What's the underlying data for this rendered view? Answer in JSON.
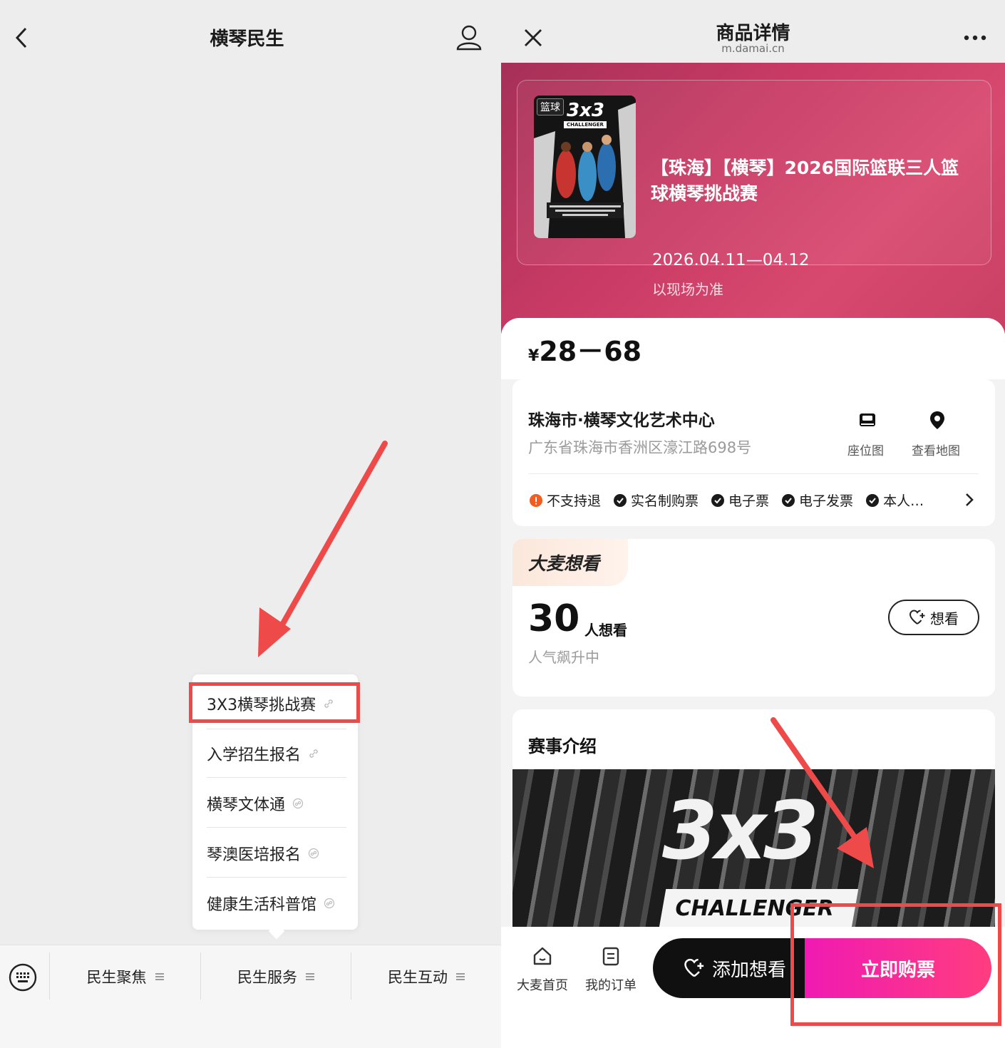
{
  "left_panel": {
    "title": "横琴民生",
    "popup_menu": {
      "items": [
        {
          "label": "3X3横琴挑战赛",
          "highlighted": true
        },
        {
          "label": "入学招生报名"
        },
        {
          "label": "横琴文体通"
        },
        {
          "label": "琴澳医培报名"
        },
        {
          "label": "健康生活科普馆"
        }
      ]
    },
    "bottom_menu": {
      "tabs": [
        {
          "label": "民生聚焦"
        },
        {
          "label": "民生服务"
        },
        {
          "label": "民生互动"
        }
      ]
    }
  },
  "right_panel": {
    "header": {
      "title": "商品详情",
      "url": "m.damai.cn"
    },
    "event": {
      "poster_tag": "篮球",
      "poster_logo": "3x3",
      "poster_sub": "CHALLENGER",
      "name": "【珠海】【横琴】2026国际篮联三人篮球横琴挑战赛",
      "date": "2026.04.11—04.12",
      "note": "以现场为准"
    },
    "price": {
      "currency": "¥",
      "range": "28－68"
    },
    "venue": {
      "name": "珠海市·横琴文化艺术中心",
      "address": "广东省珠海市香洲区濠江路698号",
      "seat_map_label": "座位图",
      "map_label": "查看地图",
      "tags": [
        {
          "label": "不支持退",
          "type": "warn"
        },
        {
          "label": "实名制购票",
          "type": "ok"
        },
        {
          "label": "电子票",
          "type": "ok"
        },
        {
          "label": "电子发票",
          "type": "ok"
        },
        {
          "label": "本人…",
          "type": "ok"
        }
      ]
    },
    "want": {
      "badge": "大麦想看",
      "count": "30",
      "count_unit": "人想看",
      "trend": "人气飙升中",
      "button": "想看"
    },
    "intro": {
      "title": "赛事介绍",
      "image_text": "3x3",
      "image_sub": "CHALLENGER"
    },
    "bottom_bar": {
      "home": "大麦首页",
      "orders": "我的订单",
      "add_want": "添加想看",
      "buy": "立即购票"
    }
  },
  "colors": {
    "annotation_red": "#ef4a4a",
    "hero_pink": "#c93b65",
    "buy_gradient_start": "#f01ab2",
    "buy_gradient_end": "#ff3d7f"
  }
}
